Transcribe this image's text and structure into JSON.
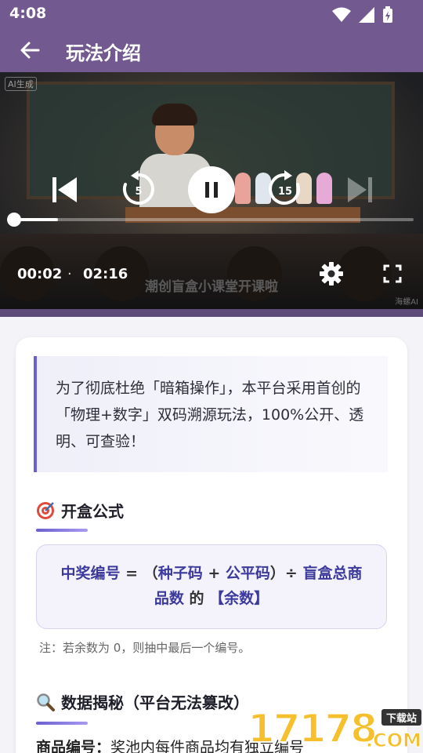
{
  "status_bar": {
    "time": "4:08"
  },
  "app_bar": {
    "title": "玩法介绍"
  },
  "video": {
    "current_time": "00:02",
    "separator": "·",
    "duration": "02:16",
    "progress": 0.015,
    "rewind_seconds": "5",
    "forward_seconds": "15",
    "subtitle": "潮创盲盒小课堂开课啦",
    "ai_tag": "AI生成",
    "corner_tag": "海螺AI"
  },
  "intro": {
    "text": "为了彻底杜绝「暗箱操作」，本平台采用首创的「物理+数字」双码溯源玩法，100%公开、透明、可查验！"
  },
  "formula_section": {
    "title": "开盒公式",
    "formula": {
      "part1": "中奖编号",
      "op1": " = （",
      "part2": "种子码",
      "op2": " + ",
      "part3": "公平码",
      "op3": "）÷ ",
      "part4": "盲盒总商品数",
      "op4": " 的 ",
      "part5": "【余数】"
    },
    "note": "注：若余数为 0，则抽中最后一个编号。"
  },
  "data_section": {
    "title": "数据揭秘（平台无法篡改）",
    "product_label": "商品编号：",
    "product_text": "奖池内每件商品均有独立编号"
  },
  "watermark": {
    "digits": "17178",
    "badge": "下载站",
    "domain": ".COM"
  },
  "colors": {
    "header": "#72598f",
    "accent": "#6b5fd0",
    "formula_text": "#3c3a9c"
  }
}
